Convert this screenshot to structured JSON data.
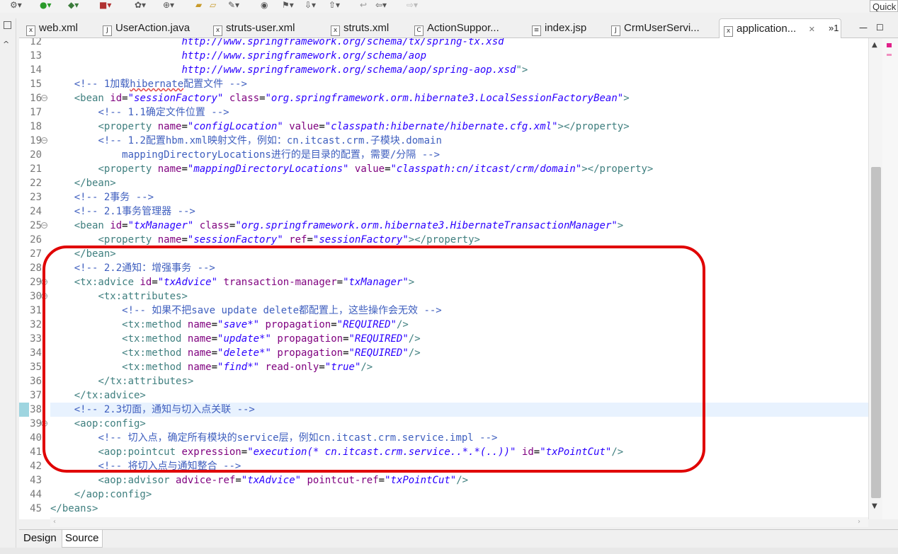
{
  "toolbar": {
    "quick_access_label": "Quick",
    "icons": [
      "settings-icon",
      "run-icon",
      "debug-icon",
      "server-icon",
      "new-class-icon",
      "link-icon",
      "open-folder-icon",
      "open-type-icon",
      "search-icon",
      "build-icon",
      "annotation-icon",
      "back-icon",
      "forward-icon"
    ]
  },
  "tabs": [
    {
      "label": "web.xml",
      "icon": "xml-file-icon",
      "active": false
    },
    {
      "label": "UserAction.java",
      "icon": "java-file-icon",
      "active": false
    },
    {
      "label": "struts-user.xml",
      "icon": "xml-file-icon",
      "active": false
    },
    {
      "label": "struts.xml",
      "icon": "xml-file-icon",
      "active": false
    },
    {
      "label": "ActionSuppor...",
      "icon": "class-file-icon",
      "active": false
    },
    {
      "label": "index.jsp",
      "icon": "jsp-file-icon",
      "active": false
    },
    {
      "label": "CrmUserServi...",
      "icon": "java-file-icon",
      "active": false
    },
    {
      "label": "application...",
      "icon": "xml-file-icon",
      "active": true
    }
  ],
  "tab_overflow_label": "»1",
  "editor": {
    "lines": [
      {
        "n": "12",
        "html": "                      <span class=\"val\">http://www.springframework.org/schema/tx/spring-tx.xsd</span>"
      },
      {
        "n": "13",
        "html": "                      <span class=\"val\">http://www.springframework.org/schema/aop</span>"
      },
      {
        "n": "14",
        "html": "                      <span class=\"val\">http://www.springframework.org/schema/aop/spring-aop.xsd</span><span class=\"tag\">\"&gt;</span>"
      },
      {
        "n": "15",
        "html": "    <span class=\"cmt\">&lt;!-- 1加载<span class=\"sq\">hibernate</span>配置文件 --&gt;</span>"
      },
      {
        "n": "16",
        "fold": true,
        "html": "    <span class=\"tag\">&lt;bean</span> <span class=\"attr\">id</span>=<span class=\"val\">\"sessionFactory\"</span> <span class=\"attr\">class</span>=<span class=\"val\">\"org.springframework.orm.hibernate3.LocalSessionFactoryBean\"</span><span class=\"tag\">&gt;</span>"
      },
      {
        "n": "17",
        "html": "        <span class=\"cmt\">&lt;!-- 1.1确定文件位置 --&gt;</span>"
      },
      {
        "n": "18",
        "html": "        <span class=\"tag\">&lt;property</span> <span class=\"attr\">name</span>=<span class=\"val\">\"configLocation\"</span> <span class=\"attr\">value</span>=<span class=\"val\">\"classpath:hibernate/hibernate.cfg.xml\"</span><span class=\"tag\">&gt;&lt;/property&gt;</span>"
      },
      {
        "n": "19",
        "fold": true,
        "html": "        <span class=\"cmt\">&lt;!-- 1.2配置hbm.xml映射文件，例如：cn.itcast.crm.子模块.domain</span>"
      },
      {
        "n": "20",
        "html": "<span class=\"cmt\">            mappingDirectoryLocations进行的是目录的配置，需要/分隔 --&gt;</span>"
      },
      {
        "n": "21",
        "html": "        <span class=\"tag\">&lt;property</span> <span class=\"attr\">name</span>=<span class=\"val\">\"mappingDirectoryLocations\"</span> <span class=\"attr\">value</span>=<span class=\"val\">\"classpath:cn/itcast/crm/domain\"</span><span class=\"tag\">&gt;&lt;/property&gt;</span>"
      },
      {
        "n": "22",
        "html": "    <span class=\"tag\">&lt;/bean&gt;</span>"
      },
      {
        "n": "23",
        "html": "    <span class=\"cmt\">&lt;!-- 2事务 --&gt;</span>"
      },
      {
        "n": "24",
        "html": "    <span class=\"cmt\">&lt;!-- 2.1事务管理器 --&gt;</span>"
      },
      {
        "n": "25",
        "fold": true,
        "html": "    <span class=\"tag\">&lt;bean</span> <span class=\"attr\">id</span>=<span class=\"val\">\"txManager\"</span> <span class=\"attr\">class</span>=<span class=\"val\">\"org.springframework.orm.hibernate3.HibernateTransactionManager\"</span><span class=\"tag\">&gt;</span>"
      },
      {
        "n": "26",
        "html": "        <span class=\"tag\">&lt;property</span> <span class=\"attr\">name</span>=<span class=\"val\">\"sessionFactory\"</span> <span class=\"attr\">ref</span>=<span class=\"val\">\"sessionFactory\"</span><span class=\"tag\">&gt;&lt;/property&gt;</span>"
      },
      {
        "n": "27",
        "html": "    <span class=\"tag\">&lt;/bean&gt;</span>"
      },
      {
        "n": "28",
        "html": "    <span class=\"cmt\">&lt;!-- 2.2通知：增强事务 --&gt;</span>"
      },
      {
        "n": "29",
        "fold": true,
        "html": "    <span class=\"tag\">&lt;tx:advice</span> <span class=\"attr\">id</span>=<span class=\"val\">\"txAdvice\"</span> <span class=\"attr\">transaction-manager</span>=<span class=\"val\">\"txManager\"</span><span class=\"tag\">&gt;</span>"
      },
      {
        "n": "30",
        "fold": true,
        "html": "        <span class=\"tag\">&lt;tx:attributes&gt;</span>"
      },
      {
        "n": "31",
        "html": "            <span class=\"cmt\">&lt;!-- 如果不把save update delete都配置上，这些操作会无效 --&gt;</span>"
      },
      {
        "n": "32",
        "html": "            <span class=\"tag\">&lt;tx:method</span> <span class=\"attr\">name</span>=<span class=\"val\">\"save*\"</span> <span class=\"attr\">propagation</span>=<span class=\"val\">\"REQUIRED\"</span><span class=\"tag\">/&gt;</span>"
      },
      {
        "n": "33",
        "html": "            <span class=\"tag\">&lt;tx:method</span> <span class=\"attr\">name</span>=<span class=\"val\">\"update*\"</span> <span class=\"attr\">propagation</span>=<span class=\"val\">\"REQUIRED\"</span><span class=\"tag\">/&gt;</span>"
      },
      {
        "n": "34",
        "html": "            <span class=\"tag\">&lt;tx:method</span> <span class=\"attr\">name</span>=<span class=\"val\">\"delete*\"</span> <span class=\"attr\">propagation</span>=<span class=\"val\">\"REQUIRED\"</span><span class=\"tag\">/&gt;</span>"
      },
      {
        "n": "35",
        "html": "            <span class=\"tag\">&lt;tx:method</span> <span class=\"attr\">name</span>=<span class=\"val\">\"find*\"</span> <span class=\"attr\">read-only</span>=<span class=\"val\">\"true\"</span><span class=\"tag\">/&gt;</span>"
      },
      {
        "n": "36",
        "html": "        <span class=\"tag\">&lt;/tx:attributes&gt;</span>"
      },
      {
        "n": "37",
        "html": "    <span class=\"tag\">&lt;/tx:advice&gt;</span>"
      },
      {
        "n": "38",
        "current": true,
        "html": "    <span class=\"cmt\">&lt;!-- 2.3切面，通知与切入点关联 --&gt;</span>"
      },
      {
        "n": "39",
        "fold": true,
        "html": "    <span class=\"tag\">&lt;aop:config&gt;</span>"
      },
      {
        "n": "40",
        "html": "        <span class=\"cmt\">&lt;!-- 切入点，确定所有模块的service层，例如cn.itcast.crm.service.impl --&gt;</span>"
      },
      {
        "n": "41",
        "html": "        <span class=\"tag\">&lt;aop:pointcut</span> <span class=\"attr\">expression</span>=<span class=\"val\">\"execution(* cn.itcast.crm.service..*.*(..))\"</span> <span class=\"attr\">id</span>=<span class=\"val\">\"txPointCut\"</span><span class=\"tag\">/&gt;</span>"
      },
      {
        "n": "42",
        "html": "        <span class=\"cmt\">&lt;!-- 将切入点与通知整合 --&gt;</span>"
      },
      {
        "n": "43",
        "html": "        <span class=\"tag\">&lt;aop:advisor</span> <span class=\"attr\">advice-ref</span>=<span class=\"val\">\"txAdvice\"</span> <span class=\"attr\">pointcut-ref</span>=<span class=\"val\">\"txPointCut\"</span><span class=\"tag\">/&gt;</span>"
      },
      {
        "n": "44",
        "html": "    <span class=\"tag\">&lt;/aop:config&gt;</span>"
      },
      {
        "n": "45",
        "html": "<span class=\"tag\">&lt;/beans&gt;</span>"
      }
    ]
  },
  "bottom_tabs": [
    {
      "label": "Design",
      "active": false
    },
    {
      "label": "Source",
      "active": true
    }
  ],
  "colors": {
    "annotation": "#e00000",
    "xml_tag": "#3f7f7f",
    "xml_attr": "#7f007f",
    "xml_value": "#2a00ff",
    "xml_comment": "#3f5fbf"
  }
}
